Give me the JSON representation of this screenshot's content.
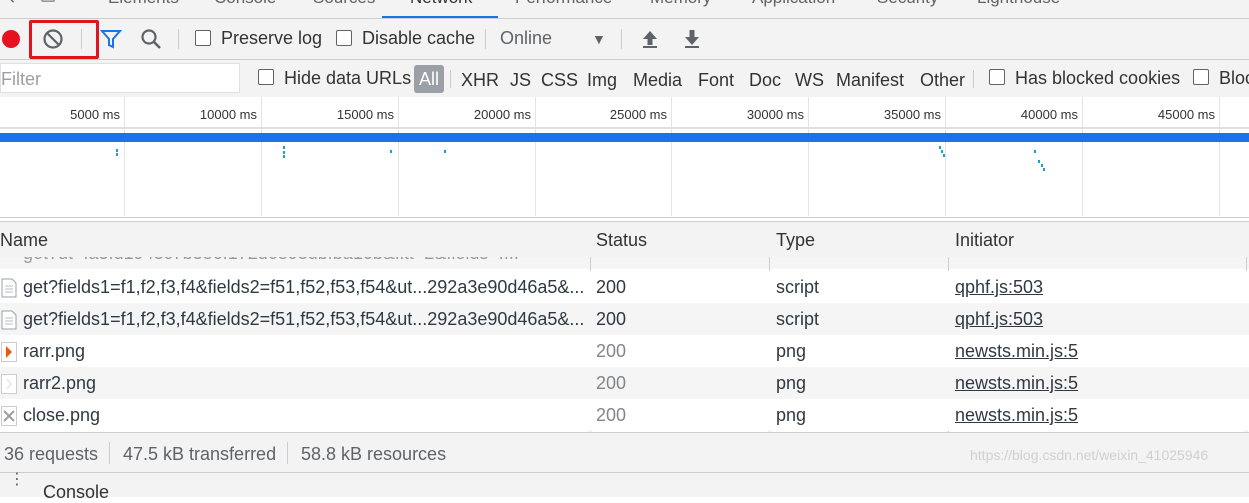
{
  "tabs": [
    "Elements",
    "Console",
    "Sources",
    "Network",
    "Performance",
    "Memory",
    "Application",
    "Security",
    "Lighthouse"
  ],
  "active_tab": "Network",
  "toolbar": {
    "preserve_log": "Preserve log",
    "disable_cache": "Disable cache",
    "throttle_value": "Online"
  },
  "filter": {
    "placeholder": "Filter",
    "hide_data_urls": "Hide data URLs",
    "types": [
      "All",
      "XHR",
      "JS",
      "CSS",
      "Img",
      "Media",
      "Font",
      "Doc",
      "WS",
      "Manifest",
      "Other"
    ],
    "has_blocked_cookies": "Has blocked cookies",
    "blocked_truncated": "Bloc"
  },
  "overview": {
    "ticks": [
      "5000 ms",
      "10000 ms",
      "15000 ms",
      "20000 ms",
      "25000 ms",
      "30000 ms",
      "35000 ms",
      "40000 ms",
      "45000 ms"
    ]
  },
  "table": {
    "headers": {
      "name": "Name",
      "status": "Status",
      "type": "Type",
      "initiator": "Initiator"
    },
    "rows": [
      {
        "name": "get?fields1=f1,f2,f3,f4&fields2=f51,f52,f53,f54&ut...292a3e90d46a5&...",
        "status": "200",
        "type": "script",
        "initiator": "qphf.js:503",
        "icon": "document-icon",
        "dim": false
      },
      {
        "name": "get?fields1=f1,f2,f3,f4&fields2=f51,f52,f53,f54&ut...292a3e90d46a5&...",
        "status": "200",
        "type": "script",
        "initiator": "qphf.js:503",
        "icon": "document-icon",
        "dim": false
      },
      {
        "name": "rarr.png",
        "status": "200",
        "type": "png",
        "initiator": "newsts.min.js:5",
        "icon": "image-arrow-icon",
        "dim": true
      },
      {
        "name": "rarr2.png",
        "status": "200",
        "type": "png",
        "initiator": "newsts.min.js:5",
        "icon": "image-blank-icon",
        "dim": true
      },
      {
        "name": "close.png",
        "status": "200",
        "type": "png",
        "initiator": "newsts.min.js:5",
        "icon": "image-close-icon",
        "dim": true
      }
    ]
  },
  "status": {
    "requests": "36 requests",
    "transferred": "47.5 kB transferred",
    "resources": "58.8 kB resources"
  },
  "drawer": {
    "title": "Console"
  },
  "watermark": "https://blog.csdn.net/weixin_41025946",
  "colors": {
    "record": "#e8111f",
    "highlight_box": "#e0141e",
    "timeline_bar": "#1a73e8",
    "accent": "#1a73e8"
  }
}
